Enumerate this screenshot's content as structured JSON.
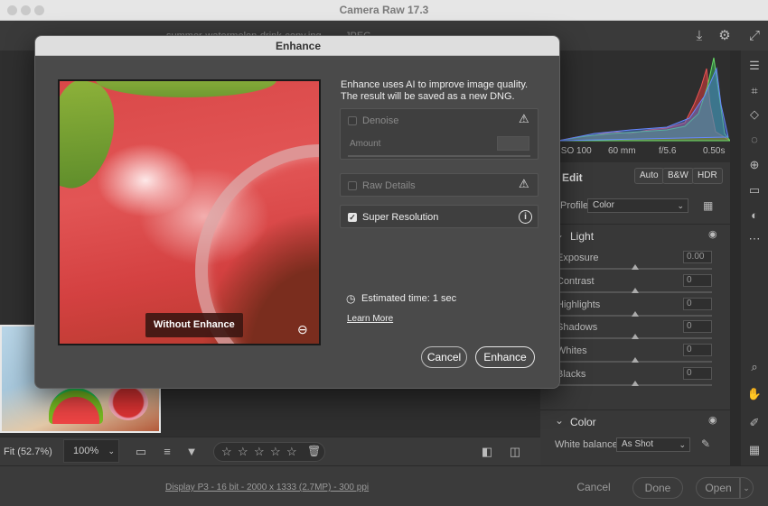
{
  "window": {
    "title": "Camera Raw 17.3"
  },
  "topbar": {
    "filename": "summer-watermelon-drink-copy.jpg",
    "filetype": "JPEG"
  },
  "histogram": {
    "iso": "ISO 100",
    "focal": "60 mm",
    "aperture": "f/5.6",
    "shutter": "0.50s"
  },
  "edit": {
    "label": "Edit",
    "buttons": [
      "Auto",
      "B&W",
      "HDR"
    ],
    "profile_label": "Profile",
    "profile_value": "Color",
    "light": {
      "label": "Light",
      "sliders": [
        {
          "label": "Exposure",
          "value": "0.00"
        },
        {
          "label": "Contrast",
          "value": "0"
        },
        {
          "label": "Highlights",
          "value": "0"
        },
        {
          "label": "Shadows",
          "value": "0"
        },
        {
          "label": "Whites",
          "value": "0"
        },
        {
          "label": "Blacks",
          "value": "0"
        }
      ]
    },
    "color": {
      "label": "Color",
      "wb_label": "White balance",
      "wb_value": "As Shot"
    }
  },
  "bottombar": {
    "fit": "Fit (52.7%)",
    "zoom": "100%"
  },
  "statusbar": {
    "info": "Display P3 - 16 bit - 2000 x 1333 (2.7MP) - 300 ppi",
    "cancel": "Cancel",
    "done": "Done",
    "open": "Open"
  },
  "modal": {
    "title": "Enhance",
    "description": "Enhance uses AI to improve image quality. The result will be saved as a new DNG.",
    "preview_badge": "Without Enhance",
    "denoise": {
      "label": "Denoise",
      "amount_label": "Amount",
      "checked": false
    },
    "raw_details": {
      "label": "Raw Details",
      "checked": false
    },
    "super_resolution": {
      "label": "Super Resolution",
      "checked": true
    },
    "estimated_time": "Estimated time: 1 sec",
    "learn_more": "Learn More",
    "cancel_label": "Cancel",
    "enhance_label": "Enhance"
  },
  "colors": {
    "accent": "#e6e6e6",
    "dialog_bg": "#4a4a4a",
    "panel_bg": "#383838"
  }
}
